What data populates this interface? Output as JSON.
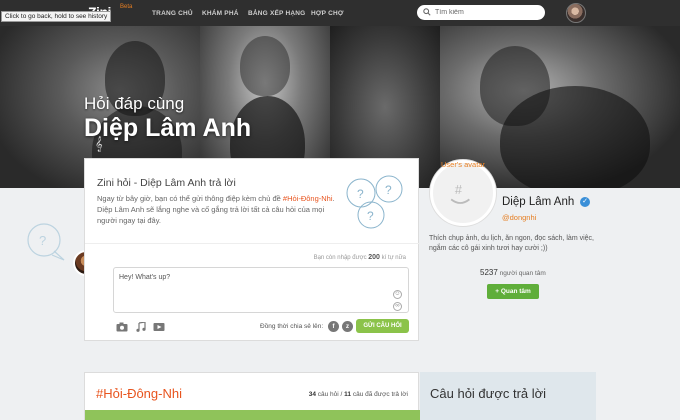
{
  "tooltip": "Click to go back, hold to see history",
  "app": {
    "logo": "Zini",
    "badge": "Beta"
  },
  "nav": [
    {
      "label": "TRANG CHỦ"
    },
    {
      "label": "KHÁM PHÁ"
    },
    {
      "label": "BẢNG XẾP HẠNG"
    },
    {
      "label": "HỢP CHỢ"
    }
  ],
  "search": {
    "placeholder": "Tìm kiếm"
  },
  "cover": {
    "subtitle": "Hỏi đáp cùng",
    "title": "Diệp Lâm Anh"
  },
  "ask_card": {
    "title": "Zini hỏi - Diệp Lâm Anh trả lời",
    "desc_before": "Ngay từ bây giờ, bạn có thể gửi thông điệp kèm chủ đề ",
    "hashtag": "#Hỏi-Đông-Nhi",
    "desc_after": ". Diệp Lâm Anh sẽ lắng nghe và cố gắng trả lời tất cả câu hỏi của mọi người ngay tại đây.",
    "char_hint_prefix": "Bạn còn nhập được",
    "char_count": "200",
    "char_hint_suffix": "kí tự nữa",
    "textarea_value": "Hey! What's up?",
    "share_label": "Đồng thời chia sẻ lên:",
    "ask_button": "GỬI CÂU HỎI"
  },
  "profile": {
    "avatar_alt": "User's avatar",
    "name": "Diệp Lâm Anh",
    "handle": "@dongnhi",
    "bio": "Thích chụp ảnh, du lịch, ăn ngon, đọc sách, làm việc, ngắm các cô gái xinh tươi hay cười ;))",
    "followers_count": "5237",
    "followers_label": "người quan tâm",
    "follow_button": "Quan tâm"
  },
  "topic": {
    "hashtag": "#Hỏi-Đông-Nhi",
    "questions_count": "34",
    "questions_label": "câu hỏi /",
    "answered_count": "11",
    "answered_label": "câu đã được trả lời"
  },
  "answered_panel": {
    "title": "Câu hỏi được trả lời"
  },
  "colors": {
    "accent": "#e8541e",
    "green": "#8bc34a",
    "nav_bg": "#2f2f2f"
  }
}
